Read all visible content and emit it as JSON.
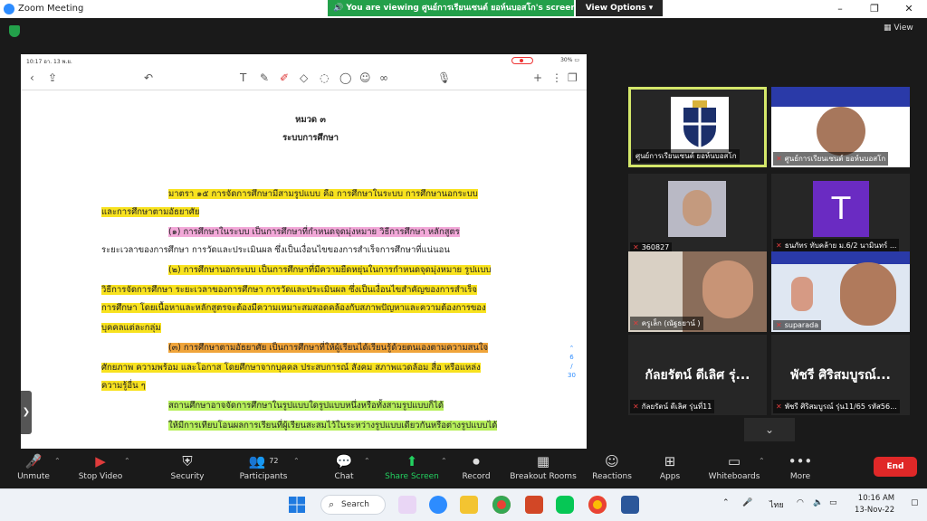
{
  "window": {
    "title": "Zoom Meeting",
    "banner": "You are viewing ศูนย์การเรียนเซนต์ ยอห์นบอสโก's screen",
    "view_options": "View Options",
    "view_label": "View"
  },
  "shared_screen": {
    "status_time": "10:17",
    "status_date": "อา. 13 พ.ย.",
    "battery": "30%",
    "page_current": "6",
    "page_total": "30",
    "doc": {
      "chapter": "หมวด ๓",
      "chapter_title": "ระบบการศึกษา",
      "lines": [
        "มาตรา ๑๕  การจัดการศึกษามีสามรูปแบบ คือ การศึกษาในระบบ การศึกษานอกระบบ",
        "และการศึกษาตามอัธยาศัย",
        "(๑) การศึกษาในระบบ เป็นการศึกษาที่กำหนดจุดมุ่งหมาย วิธีการศึกษา หลักสูตร",
        "ระยะเวลาของการศึกษา การวัดและประเมินผล ซึ่งเป็นเงื่อนไขของการสำเร็จการศึกษาที่แน่นอน",
        "(๒) การศึกษานอกระบบ เป็นการศึกษาที่มีความยืดหยุ่นในการกำหนดจุดมุ่งหมาย รูปแบบ",
        "วิธีการจัดการศึกษา ระยะเวลาของการศึกษา การวัดและประเมินผล ซึ่งเป็นเงื่อนไขสำคัญของการสำเร็จ",
        "การศึกษา โดยเนื้อหาและหลักสูตรจะต้องมีความเหมาะสมสอดคล้องกับสภาพปัญหาและความต้องการของ",
        "บุคคลแต่ละกลุ่ม",
        "(๓) การศึกษาตามอัธยาศัย เป็นการศึกษาที่ให้ผู้เรียนได้เรียนรู้ด้วยตนเองตามความสนใจ",
        "ศักยภาพ ความพร้อม และโอกาส โดยศึกษาจากบุคคล ประสบการณ์ สังคม สภาพแวดล้อม สื่อ หรือแหล่ง",
        "ความรู้อื่น ๆ",
        "สถานศึกษาอาจจัดการศึกษาในรูปแบบใดรูปแบบหนึ่งหรือทั้งสามรูปแบบก็ได้",
        "ให้มีการเทียบโอนผลการเรียนที่ผู้เรียนสะสมไว้ในระหว่างรูปแบบเดียวกันหรือต่างรูปแบบได้"
      ]
    }
  },
  "gallery": [
    {
      "name": "ศูนย์การเรียนเซนต์ ยอห์นบอสโก",
      "muted": false,
      "kind": "logo"
    },
    {
      "name": "ศูนย์การเรียนเซนต์ ยอห์นบอสโก",
      "muted": true,
      "kind": "photo"
    },
    {
      "name": "360827",
      "muted": true,
      "kind": "photo"
    },
    {
      "name": "ธนภัทร ทับคล้าย ม.6/2 นามินทร์ ...",
      "muted": true,
      "kind": "avatar",
      "initial": "T"
    },
    {
      "name": "ครูเล็ก (ณัฐธยาน์ )",
      "muted": true,
      "kind": "photo"
    },
    {
      "name": "suparada",
      "muted": true,
      "kind": "photo"
    },
    {
      "name": "กัลยรัตน์ ดีเลิศ รุ่นที่11",
      "muted": true,
      "kind": "text",
      "display": "กัลยรัตน์ ดีเลิศ รุ่..."
    },
    {
      "name": "พัชรี ศิริสมบูรณ์ รุ่น11/65 รหัส56...",
      "muted": true,
      "kind": "text",
      "display": "พัชรี ศิริสมบูรณ์..."
    }
  ],
  "controls": {
    "unmute": "Unmute",
    "stop_video": "Stop Video",
    "security": "Security",
    "participants": "Participants",
    "participants_count": "72",
    "chat": "Chat",
    "share_screen": "Share Screen",
    "record": "Record",
    "breakout": "Breakout Rooms",
    "reactions": "Reactions",
    "apps": "Apps",
    "whiteboards": "Whiteboards",
    "more": "More",
    "end": "End"
  },
  "taskbar": {
    "search": "Search",
    "lang": "ไทย",
    "time": "10:16 AM",
    "date": "13-Nov-22"
  },
  "colors": {
    "zoom_blue": "#2d8cff",
    "banner_green": "#23a04a",
    "end_red": "#e02828",
    "highlight_yellow": "#f8e21f",
    "highlight_orange": "#f0a43a",
    "highlight_pink": "#f2a8d8",
    "highlight_green": "#b6ef5a"
  }
}
